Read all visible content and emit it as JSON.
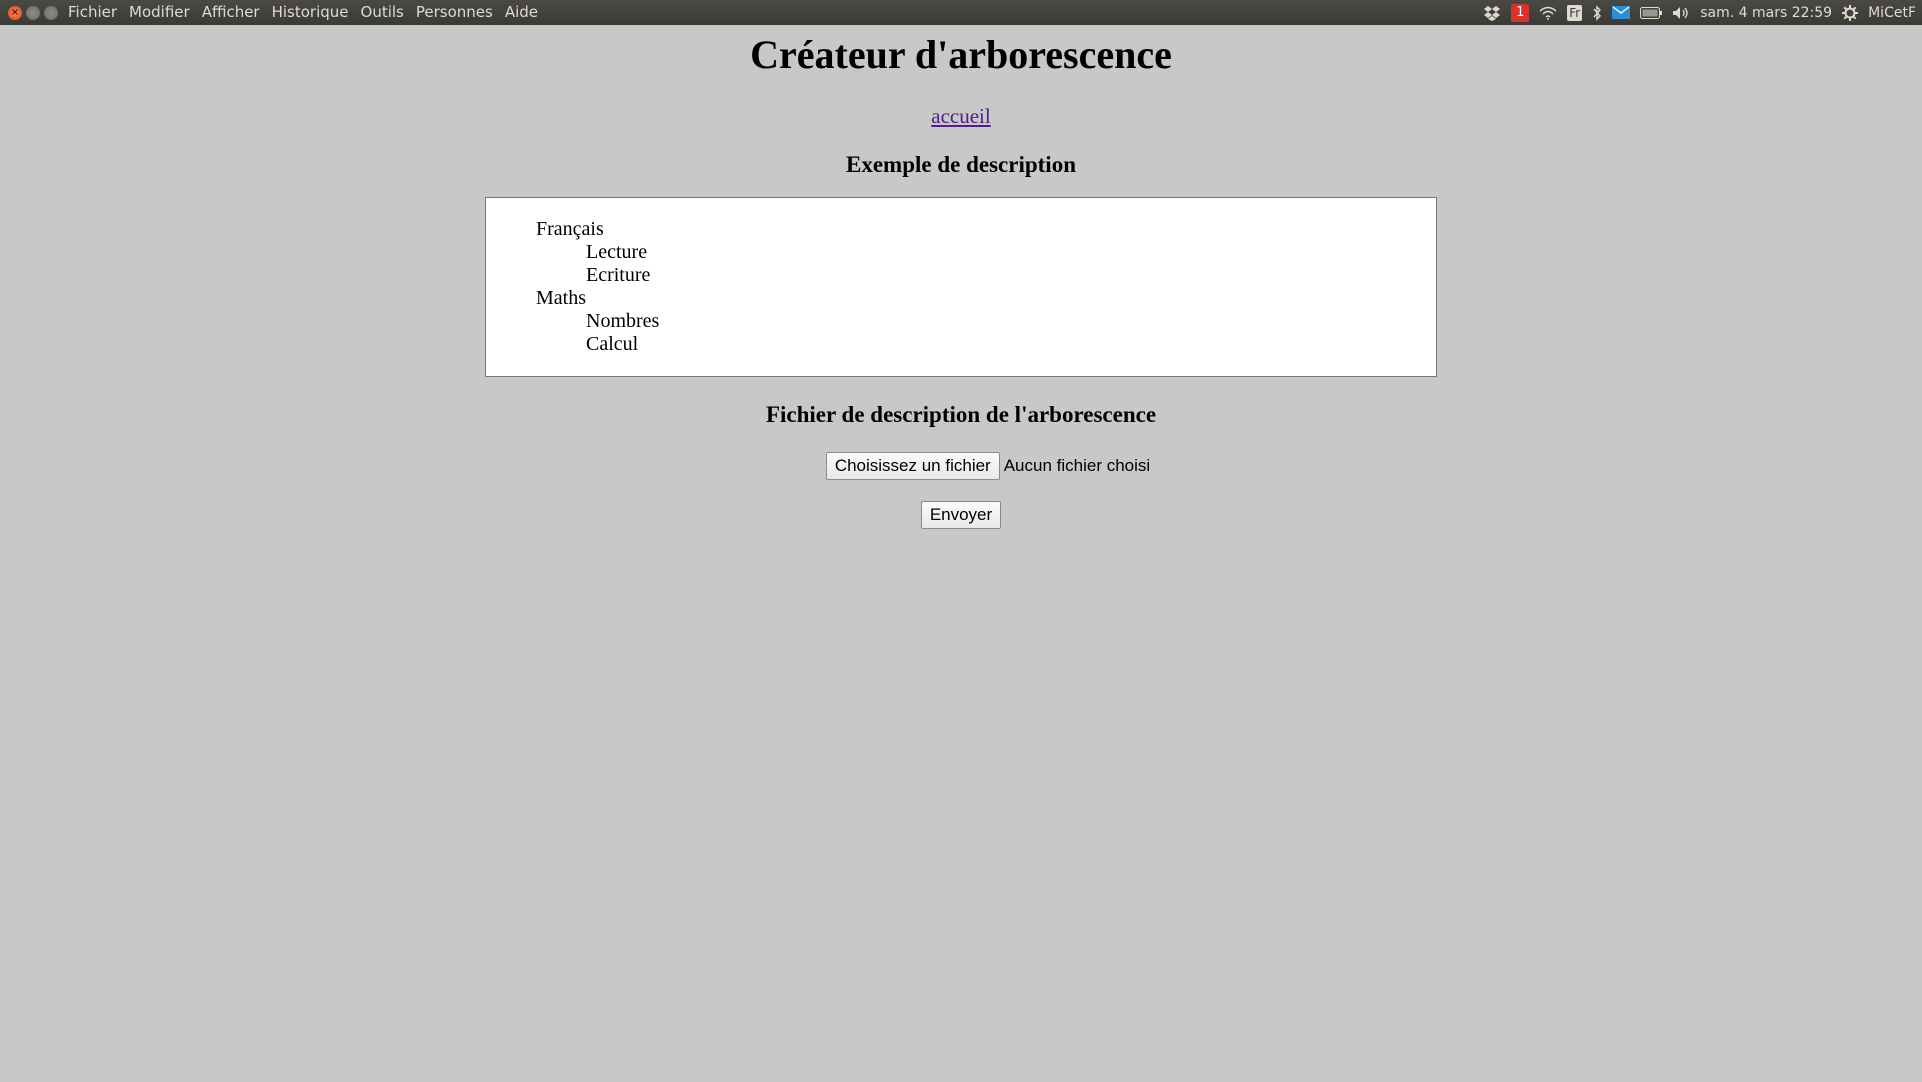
{
  "menubar": {
    "items": [
      "Fichier",
      "Modifier",
      "Afficher",
      "Historique",
      "Outils",
      "Personnes",
      "Aide"
    ]
  },
  "tray": {
    "notification_count": "1",
    "keyboard_layout": "Fr",
    "datetime": "sam. 4 mars 22:59",
    "user": "MiCetF"
  },
  "page": {
    "title": "Créateur d'arborescence",
    "home_link": "accueil",
    "example_heading": "Exemple de description",
    "example_tree": [
      {
        "label": "Français",
        "level": 1
      },
      {
        "label": "Lecture",
        "level": 2
      },
      {
        "label": "Ecriture",
        "level": 2
      },
      {
        "label": "Maths",
        "level": 1
      },
      {
        "label": "Nombres",
        "level": 2
      },
      {
        "label": "Calcul",
        "level": 2
      }
    ],
    "file_heading": "Fichier de description de l'arborescence",
    "file_button": "Choisissez un fichier",
    "file_status": "Aucun fichier choisi",
    "submit_button": "Envoyer"
  }
}
